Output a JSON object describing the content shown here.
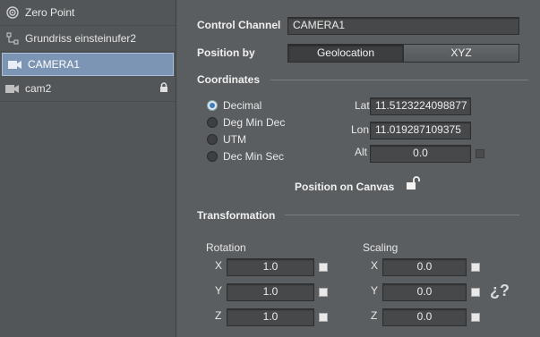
{
  "sidebar": {
    "items": [
      {
        "label": "Zero Point",
        "icon": "target-icon",
        "selected": false,
        "locked": false
      },
      {
        "label": "Grundriss einsteinufer2",
        "icon": "hierarchy-icon",
        "selected": false,
        "locked": false
      },
      {
        "label": "CAMERA1",
        "icon": "camera-icon",
        "selected": true,
        "locked": false
      },
      {
        "label": "cam2",
        "icon": "camera-icon",
        "selected": false,
        "locked": true
      }
    ]
  },
  "control_channel": {
    "label": "Control Channel",
    "value": "CAMERA1"
  },
  "position_by": {
    "label": "Position by",
    "options": [
      "Geolocation",
      "XYZ"
    ],
    "selected": "Geolocation"
  },
  "coordinates": {
    "title": "Coordinates",
    "formats": [
      "Decimal",
      "Deg Min Dec",
      "UTM",
      "Dec Min Sec"
    ],
    "selected_format": "Decimal",
    "lat_label": "Lat",
    "lat_value": "11.5123224098877",
    "lon_label": "Lon",
    "lon_value": "11.019287109375",
    "alt_label": "Alt",
    "alt_value": "0.0"
  },
  "position_on_canvas": {
    "label": "Position on Canvas",
    "locked": false
  },
  "transformation": {
    "title": "Transformation",
    "rotation": {
      "label": "Rotation",
      "x_label": "X",
      "x": "1.0",
      "y_label": "Y",
      "y": "1.0",
      "z_label": "Z",
      "z": "1.0"
    },
    "scaling": {
      "label": "Scaling",
      "x_label": "X",
      "x": "0.0",
      "y_label": "Y",
      "y": "0.0",
      "z_label": "Z",
      "z": "0.0"
    },
    "link_glyph": "¿?"
  },
  "colors": {
    "accent": "#7d95b4",
    "radio_dot": "#3f7fbf"
  }
}
